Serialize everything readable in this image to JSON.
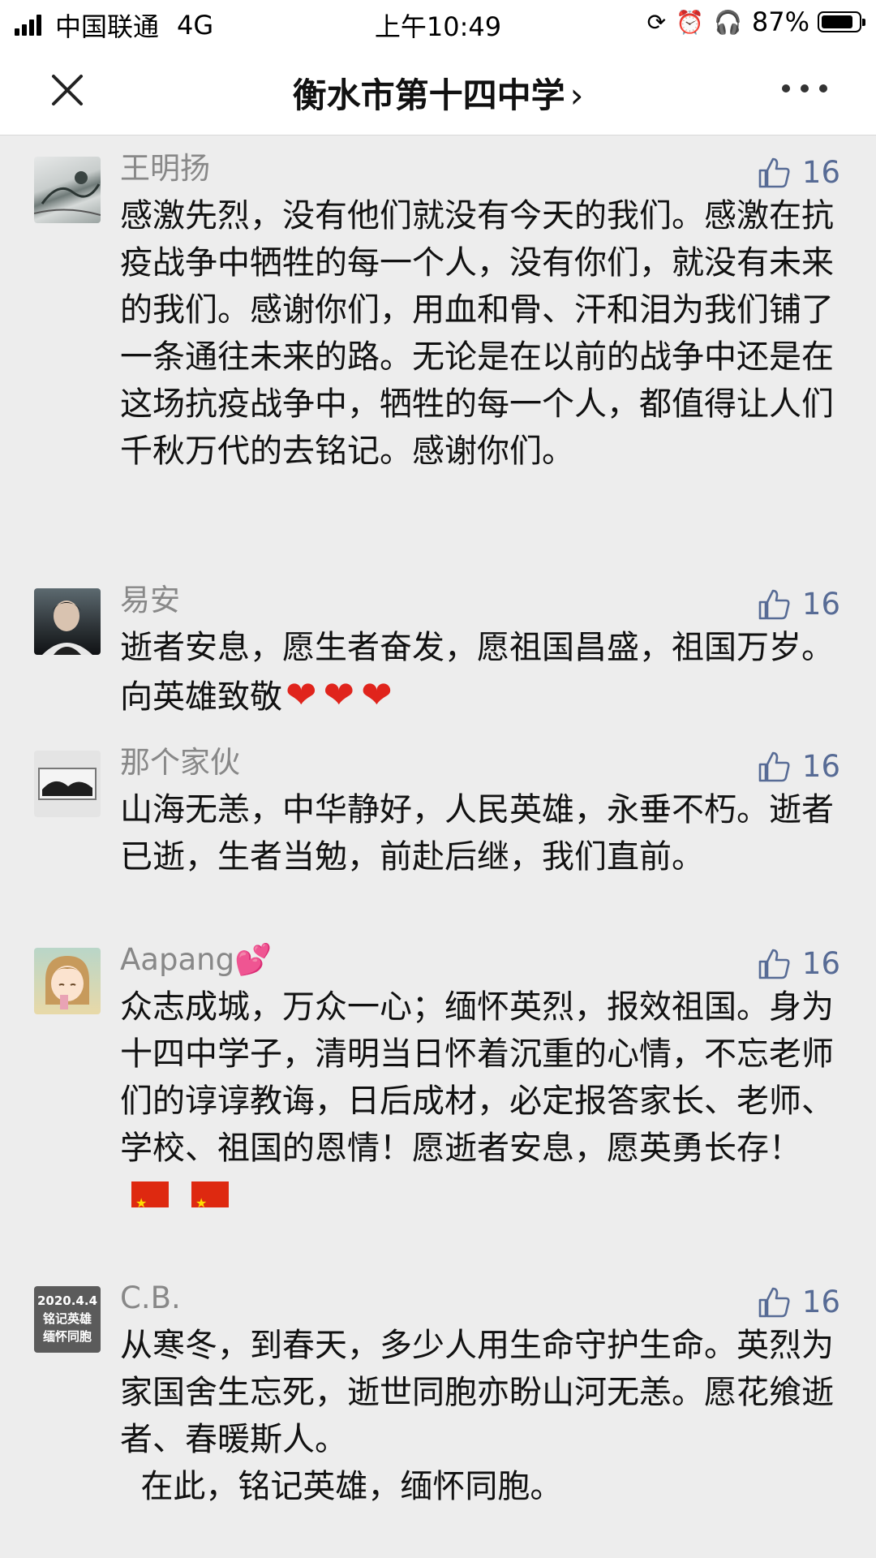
{
  "status_bar": {
    "carrier": "中国联通",
    "network": "4G",
    "time": "上午10:49",
    "battery": "87%",
    "battery_level": 0.87
  },
  "nav": {
    "title": "衡水市第十四中学",
    "chevron": "›"
  },
  "comments": [
    {
      "name": "王明扬",
      "likes": "16",
      "avatar_icon": "ink-painting-avatar",
      "text": "感激先烈，没有他们就没有今天的我们。感激在抗疫战争中牺牲的每一个人，没有你们，就没有未来的我们。感谢你们，用血和骨、汗和泪为我们铺了一条通往未来的路。无论是在以前的战争中还是在这场抗疫战争中，牺牲的每一个人，都值得让人们千秋万代的去铭记。感谢你们。"
    },
    {
      "name": "易安",
      "likes": "16",
      "avatar_icon": "portrait-avatar",
      "text": "逝者安息，愿生者奋发，愿祖国昌盛，祖国万岁。向英雄致敬",
      "hearts": [
        "❤",
        "❤",
        "❤"
      ]
    },
    {
      "name": "那个家伙",
      "likes": "16",
      "avatar_icon": "landscape-avatar",
      "text": "山海无恙，中华静好，人民英雄，永垂不朽。逝者已逝，生者当勉，前赴后继，我们直前。"
    },
    {
      "name": "Aapang",
      "name_emoji": "💕",
      "likes": "16",
      "avatar_icon": "anime-girl-avatar",
      "text": "众志成城，万众一心；缅怀英烈，报效祖国。身为十四中学子，清明当日怀着沉重的心情，不忘老师们的谆谆教诲，日后成材，必定报答家长、老师、学校、祖国的恩情！愿逝者安息，愿英勇长存！"
    },
    {
      "name": "C.B.",
      "likes": "16",
      "avatar_icon": "text-badge-avatar",
      "avatar_text": [
        "2020.4.4",
        "铭记英雄",
        "缅怀同胞"
      ],
      "text": "从寒冬，到春天，多少人用生命守护生命。英烈为家国舍生忘死，逝世同胞亦盼山河无恙。愿花飨逝者、春暖斯人。\n  在此，铭记英雄，缅怀同胞。"
    }
  ],
  "colors": {
    "like_blue": "#576b95",
    "name_gray": "#888888",
    "background": "#ededed"
  }
}
